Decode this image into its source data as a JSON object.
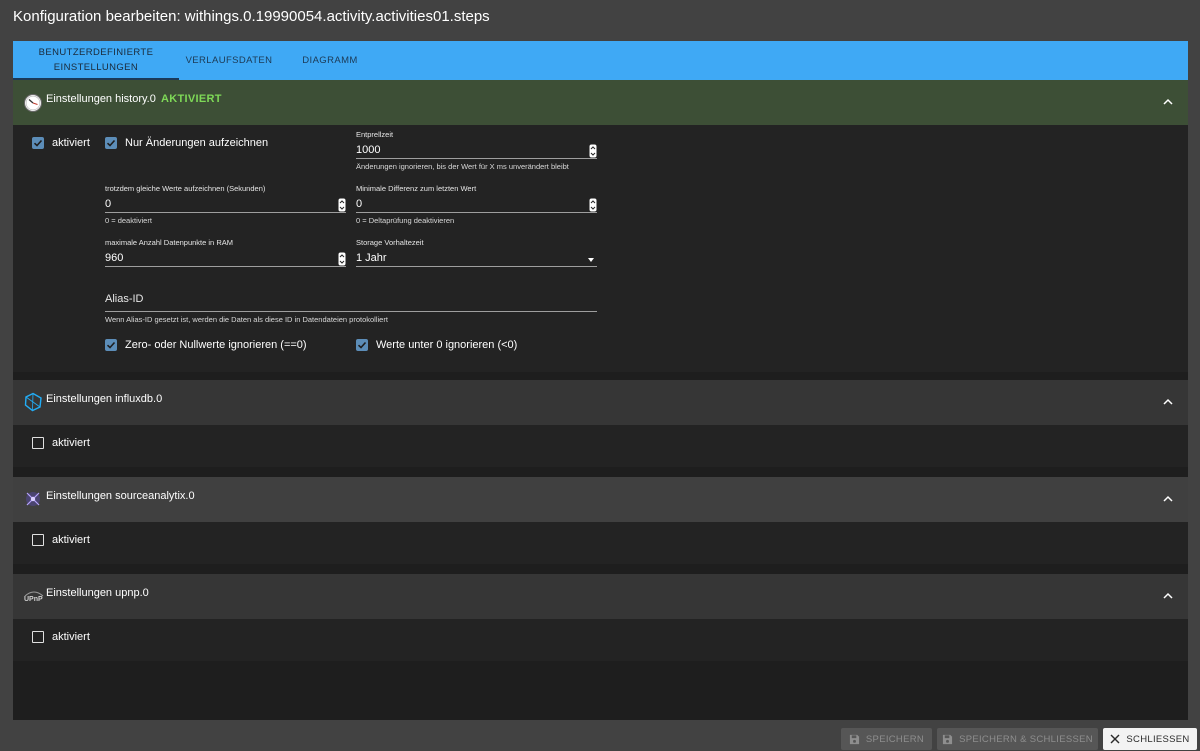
{
  "dialog": {
    "title": "Konfiguration bearbeiten: withings.0.19990054.activity.activities01.steps"
  },
  "tabs": [
    {
      "label": "BENUTZERDEFINIERTE EINSTELLUNGEN",
      "line1": "BENUTZERDEFINIERTE",
      "line2": "EINSTELLUNGEN",
      "active": true
    },
    {
      "label": "VERLAUFSDATEN",
      "active": false
    },
    {
      "label": "DIAGRAMM",
      "active": false
    }
  ],
  "history": {
    "title": "Einstellungen history.0",
    "status": "AKTIVIERT",
    "icon": "clock-icon",
    "enabled_label": "aktiviert",
    "only_changes_label": "Nur Änderungen aufzeichnen",
    "debounce": {
      "label": "Entprellzeit",
      "value": "1000",
      "help": "Änderungen ignorieren, bis der Wert für X ms unverändert bleibt"
    },
    "same_values": {
      "label": "trotzdem gleiche Werte aufzeichnen (Sekunden)",
      "value": "0",
      "help": "0 = deaktiviert"
    },
    "min_diff": {
      "label": "Minimale Differenz zum letzten Wert",
      "value": "0",
      "help": "0 = Deltaprüfung deaktivieren"
    },
    "max_points": {
      "label": "maximale Anzahl Datenpunkte in RAM",
      "value": "960"
    },
    "retention": {
      "label": "Storage Vorhaltezeit",
      "value": "1 Jahr"
    },
    "alias": {
      "placeholder": "Alias-ID",
      "help": "Wenn Alias-ID gesetzt ist, werden die Daten als diese ID in Datendateien protokolliert"
    },
    "ignore_zero_label": "Zero- oder Nullwerte ignorieren (==0)",
    "ignore_below_zero_label": "Werte unter 0 ignorieren (<0)"
  },
  "influxdb": {
    "title": "Einstellungen influxdb.0",
    "enabled_label": "aktiviert",
    "icon": "influxdb-icon"
  },
  "sourceanalytix": {
    "title": "Einstellungen sourceanalytix.0",
    "enabled_label": "aktiviert",
    "icon": "sourceanalytix-icon"
  },
  "upnp": {
    "title": "Einstellungen upnp.0",
    "enabled_label": "aktiviert",
    "icon": "upnp-icon",
    "logo_text": "UPnP"
  },
  "footer": {
    "save_label": "SPEICHERN",
    "save_close_label": "SPEICHERN & SCHLIESSEN",
    "close_label": "SCHLIESSEN"
  },
  "colors": {
    "tab_bar": "#3fa9f5",
    "history_header": "#3d4f36",
    "status_active": "#7ed957",
    "checkbox": "#5c8db8"
  }
}
